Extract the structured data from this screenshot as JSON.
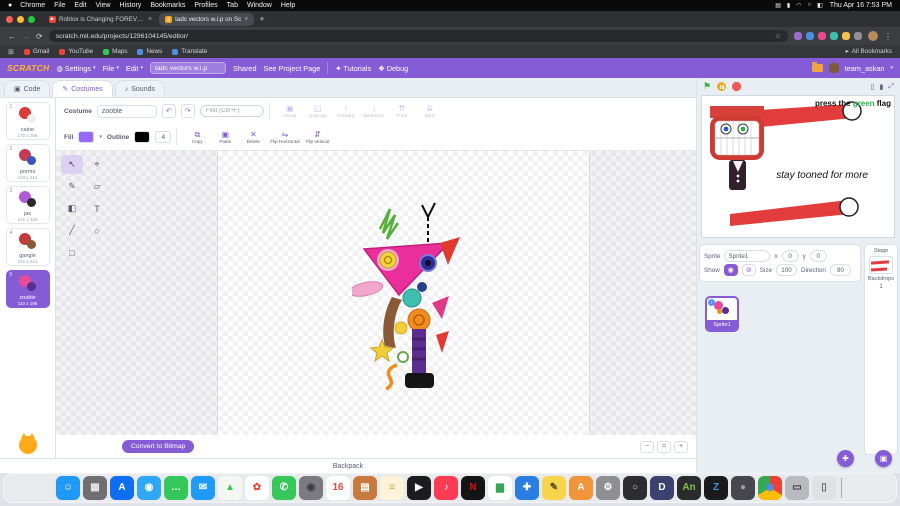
{
  "menubar": {
    "apple_icon": "●",
    "items": [
      "Chrome",
      "File",
      "Edit",
      "View",
      "History",
      "Bookmarks",
      "Profiles",
      "Tab",
      "Window",
      "Help"
    ],
    "status_icons": [
      {
        "name": "display-icon",
        "glyph": "▤"
      },
      {
        "name": "battery-icon",
        "glyph": "▮"
      },
      {
        "name": "wifi-icon",
        "glyph": "◠"
      },
      {
        "name": "spotlight-icon",
        "glyph": "○"
      },
      {
        "name": "control-center-icon",
        "glyph": "◧"
      }
    ],
    "clock": "Thu Apr 16 7:53 PM"
  },
  "browser": {
    "tabs": [
      {
        "title": "Roblox is Changing FOREVER!",
        "favicon_bg": "#e8453c",
        "favicon_glyph": "▶",
        "state": "inactive"
      },
      {
        "title": "tadc vectors w.i.p on Sc",
        "favicon_bg": "#f5a623",
        "favicon_glyph": "S",
        "state": "active"
      }
    ],
    "close_icon": "×",
    "new_tab_icon": "+",
    "nav": {
      "back": "←",
      "forward": "→",
      "reload": "⟳"
    },
    "url": "scratch.mit.edu/projects/1296104145/editor/",
    "bookmark_star": "☆",
    "extension_dots": [
      "#9a6bd0",
      "#4a90e2",
      "#e84a8a",
      "#3fbfae",
      "#f2c14e",
      "#8e8e93"
    ],
    "menu_icon": "⋮",
    "apps_icon": "⊞",
    "bookmarks": [
      {
        "label": "Gmail",
        "color": "#e8453c"
      },
      {
        "label": "YouTube",
        "color": "#e8453c"
      },
      {
        "label": "Maps",
        "color": "#35c759"
      },
      {
        "label": "News",
        "color": "#4a90e2"
      },
      {
        "label": "Translate",
        "color": "#4a90e2"
      }
    ],
    "all_bookmarks": "All Bookmarks",
    "folder_icon": "▸"
  },
  "scratch_header": {
    "logo": "SCRATCH",
    "globe_icon": "◍",
    "caret_icon": "▾",
    "settings": "Settings",
    "file": "File",
    "edit": "Edit",
    "project_title": "tadc vectors w.i.p",
    "shared": "Shared",
    "see_project_page": "See Project Page",
    "tutorials_icon": "✦",
    "tutorials": "Tutorials",
    "debug_icon": "❖",
    "debug": "Debug",
    "username": "team_askan"
  },
  "editor_tabs": [
    {
      "label": "Code",
      "icon": "▣",
      "state": "inactive"
    },
    {
      "label": "Costumes",
      "icon": "✎",
      "state": "active"
    },
    {
      "label": "Sounds",
      "icon": "♪",
      "state": "inactive"
    }
  ],
  "costumes": [
    {
      "num": "1",
      "name": "caine",
      "size": "170 x 208",
      "c1": "#d93a3a",
      "c2": "#f0f0f0",
      "state": ""
    },
    {
      "num": "2",
      "name": "pomni",
      "size": "123 x 214",
      "c1": "#c23b4e",
      "c2": "#3b55c2",
      "state": ""
    },
    {
      "num": "3",
      "name": "jax",
      "size": "141 x 226",
      "c1": "#b05cd6",
      "c2": "#2a2a2a",
      "state": ""
    },
    {
      "num": "4",
      "name": "gangle",
      "size": "151 x 221",
      "c1": "#c43b3b",
      "c2": "#8a5a36",
      "state": ""
    },
    {
      "num": "5",
      "name": "zooble",
      "size": "110 x 196",
      "c1": "#e84a9a",
      "c2": "#5c2d91",
      "state": "selected"
    }
  ],
  "paint": {
    "costume_label": "Costume",
    "costume_name": "zooble",
    "undo_icon": "↶",
    "redo_icon": "↷",
    "find_placeholder": "Find (Ctrl+F)",
    "row1_buttons": [
      {
        "label": "Group",
        "icon": "▣"
      },
      {
        "label": "Ungroup",
        "icon": "◱"
      },
      {
        "label": "Forward",
        "icon": "↑"
      },
      {
        "label": "Backward",
        "icon": "↓"
      },
      {
        "label": "Front",
        "icon": "⇈"
      },
      {
        "label": "Back",
        "icon": "⇊"
      }
    ],
    "fill_label": "Fill",
    "fill_color": "#9966ff",
    "outline_label": "Outline",
    "outline_color": "#000000",
    "outline_width": "4",
    "row2_buttons": [
      {
        "label": "Copy",
        "icon": "⧉"
      },
      {
        "label": "Paste",
        "icon": "▣"
      },
      {
        "label": "Delete",
        "icon": "✕"
      },
      {
        "label": "Flip Horizontal",
        "icon": "⇋"
      },
      {
        "label": "Flip Vertical",
        "icon": "⇵"
      }
    ],
    "tools": [
      {
        "name": "select-tool",
        "glyph": "↖",
        "state": "selected"
      },
      {
        "name": "reshape-tool",
        "glyph": "⌖",
        "state": ""
      },
      {
        "name": "brush-tool",
        "glyph": "✎",
        "state": ""
      },
      {
        "name": "eraser-tool",
        "glyph": "▱",
        "state": ""
      },
      {
        "name": "fill-tool",
        "glyph": "◧",
        "state": ""
      },
      {
        "name": "text-tool",
        "glyph": "T",
        "state": ""
      },
      {
        "name": "line-tool",
        "glyph": "╱",
        "state": ""
      },
      {
        "name": "circle-tool",
        "glyph": "○",
        "state": ""
      },
      {
        "name": "rect-tool",
        "glyph": "□",
        "state": ""
      }
    ],
    "convert_button": "Convert to Bitmap",
    "zoom_out": "−",
    "zoom_reset": "=",
    "zoom_in": "+"
  },
  "stage_area": {
    "flag_icon": "⚑",
    "text_pre": "press the ",
    "text_green": "green",
    "text_post": " flag",
    "green_color": "#2bb24c",
    "caption": "stay tooned for more",
    "small_stage_icon": "▯",
    "large_stage_icon": "▮",
    "fullscreen_icon": "⤢"
  },
  "sprite_panel": {
    "sprite_label": "Sprite",
    "sprite_name": "Sprite1",
    "x_label": "x",
    "x_value": "0",
    "y_label": "y",
    "y_value": "0",
    "show_label": "Show",
    "show_eye_icon": "◉",
    "hide_eye_icon": "⊘",
    "size_label": "Size",
    "size_value": "100",
    "direction_label": "Direction",
    "direction_value": "90",
    "info_icon": "i"
  },
  "stage_selector": {
    "stage_label": "Stage",
    "backdrops_label": "Backdrops",
    "backdrops_count": "1"
  },
  "buttons": {
    "add_sprite_icon": "✚",
    "add_backdrop_icon": "▣"
  },
  "backpack": {
    "label": "Backpack"
  },
  "dock": [
    {
      "name": "finder-dock-icon",
      "bg": "#1e99f5",
      "glyph": "☺",
      "fg": "#ffffff"
    },
    {
      "name": "launchpad-dock-icon",
      "bg": "#6e6e73",
      "glyph": "▦",
      "fg": "#e8e8e8"
    },
    {
      "name": "app-store-dock-icon",
      "bg": "#0d6ef2",
      "glyph": "A",
      "fg": "#ffffff"
    },
    {
      "name": "safari-dock-icon",
      "bg": "#2fa7f5",
      "glyph": "◉",
      "fg": "#ffffff"
    },
    {
      "name": "messages-dock-icon",
      "bg": "#35c759",
      "glyph": "…",
      "fg": "#ffffff"
    },
    {
      "name": "mail-dock-icon",
      "bg": "#1d9bf6",
      "glyph": "✉",
      "fg": "#ffffff"
    },
    {
      "name": "maps-dock-icon",
      "bg": "#f5f7f2",
      "glyph": "▲",
      "fg": "#35c759"
    },
    {
      "name": "photos-dock-icon",
      "bg": "#ffffff",
      "glyph": "✿",
      "fg": "#e8453c"
    },
    {
      "name": "facetime-dock-icon",
      "bg": "#35c759",
      "glyph": "✆",
      "fg": "#ffffff"
    },
    {
      "name": "camera-dock-icon",
      "bg": "#7a7a80",
      "glyph": "◉",
      "fg": "#3c3c40"
    },
    {
      "name": "calendar-dock-icon",
      "bg": "#ffffff",
      "glyph": "16",
      "fg": "#e8453c"
    },
    {
      "name": "books-dock-icon",
      "bg": "#c77a3d",
      "glyph": "▤",
      "fg": "#ffffff"
    },
    {
      "name": "notes-dock-icon",
      "bg": "#fdf3d8",
      "glyph": "≡",
      "fg": "#caa53d"
    },
    {
      "name": "apple-tv-dock-icon",
      "bg": "#1c1c1e",
      "glyph": "▶",
      "fg": "#ffffff"
    },
    {
      "name": "music-dock-icon",
      "bg": "#fc3c54",
      "glyph": "♪",
      "fg": "#ffffff"
    },
    {
      "name": "netflix-dock-icon",
      "bg": "#141414",
      "glyph": "N",
      "fg": "#e50914"
    },
    {
      "name": "stocks-dock-icon",
      "bg": "#ffffff",
      "glyph": "▆",
      "fg": "#34a853"
    },
    {
      "name": "blue-app-dock-icon",
      "bg": "#2a7de1",
      "glyph": "✚",
      "fg": "#ffffff"
    },
    {
      "name": "pencil-app-dock-icon",
      "bg": "#f7d44c",
      "glyph": "✎",
      "fg": "#5a4a1a"
    },
    {
      "name": "pages-app-dock-icon",
      "bg": "#f2953a",
      "glyph": "A",
      "fg": "#ffffff"
    },
    {
      "name": "utilities-dock-icon",
      "bg": "#8e8e93",
      "glyph": "⚙",
      "fg": "#ffffff"
    },
    {
      "name": "spotlight-app-dock-icon",
      "bg": "#2c2c31",
      "glyph": "○",
      "fg": "#cfcfd4"
    },
    {
      "name": "discord-dock-icon",
      "bg": "#3b4270",
      "glyph": "D",
      "fg": "#ffffff"
    },
    {
      "name": "android-studio-dock-icon",
      "bg": "#2b2b2e",
      "glyph": "An",
      "fg": "#7ec242"
    },
    {
      "name": "z-app-dock-icon",
      "bg": "#1b1b1e",
      "glyph": "Z",
      "fg": "#4a90e2"
    },
    {
      "name": "dark-app-dock-icon",
      "bg": "#46464c",
      "glyph": "●",
      "fg": "#9a9aa2"
    },
    {
      "name": "chrome-dock-icon",
      "bg": "conic-gradient(#ea4335 0deg 120deg, #fbbc05 120deg 240deg, #34a853 240deg 360deg)",
      "glyph": "◉",
      "fg": "#4a90e2"
    },
    {
      "name": "system-settings-dock-icon",
      "bg": "#b9b9c0",
      "glyph": "▭",
      "fg": "#3a3a40"
    },
    {
      "name": "trash-dock-icon",
      "bg": "rgba(220,220,225,0.65)",
      "glyph": "▯",
      "fg": "#666666"
    }
  ]
}
